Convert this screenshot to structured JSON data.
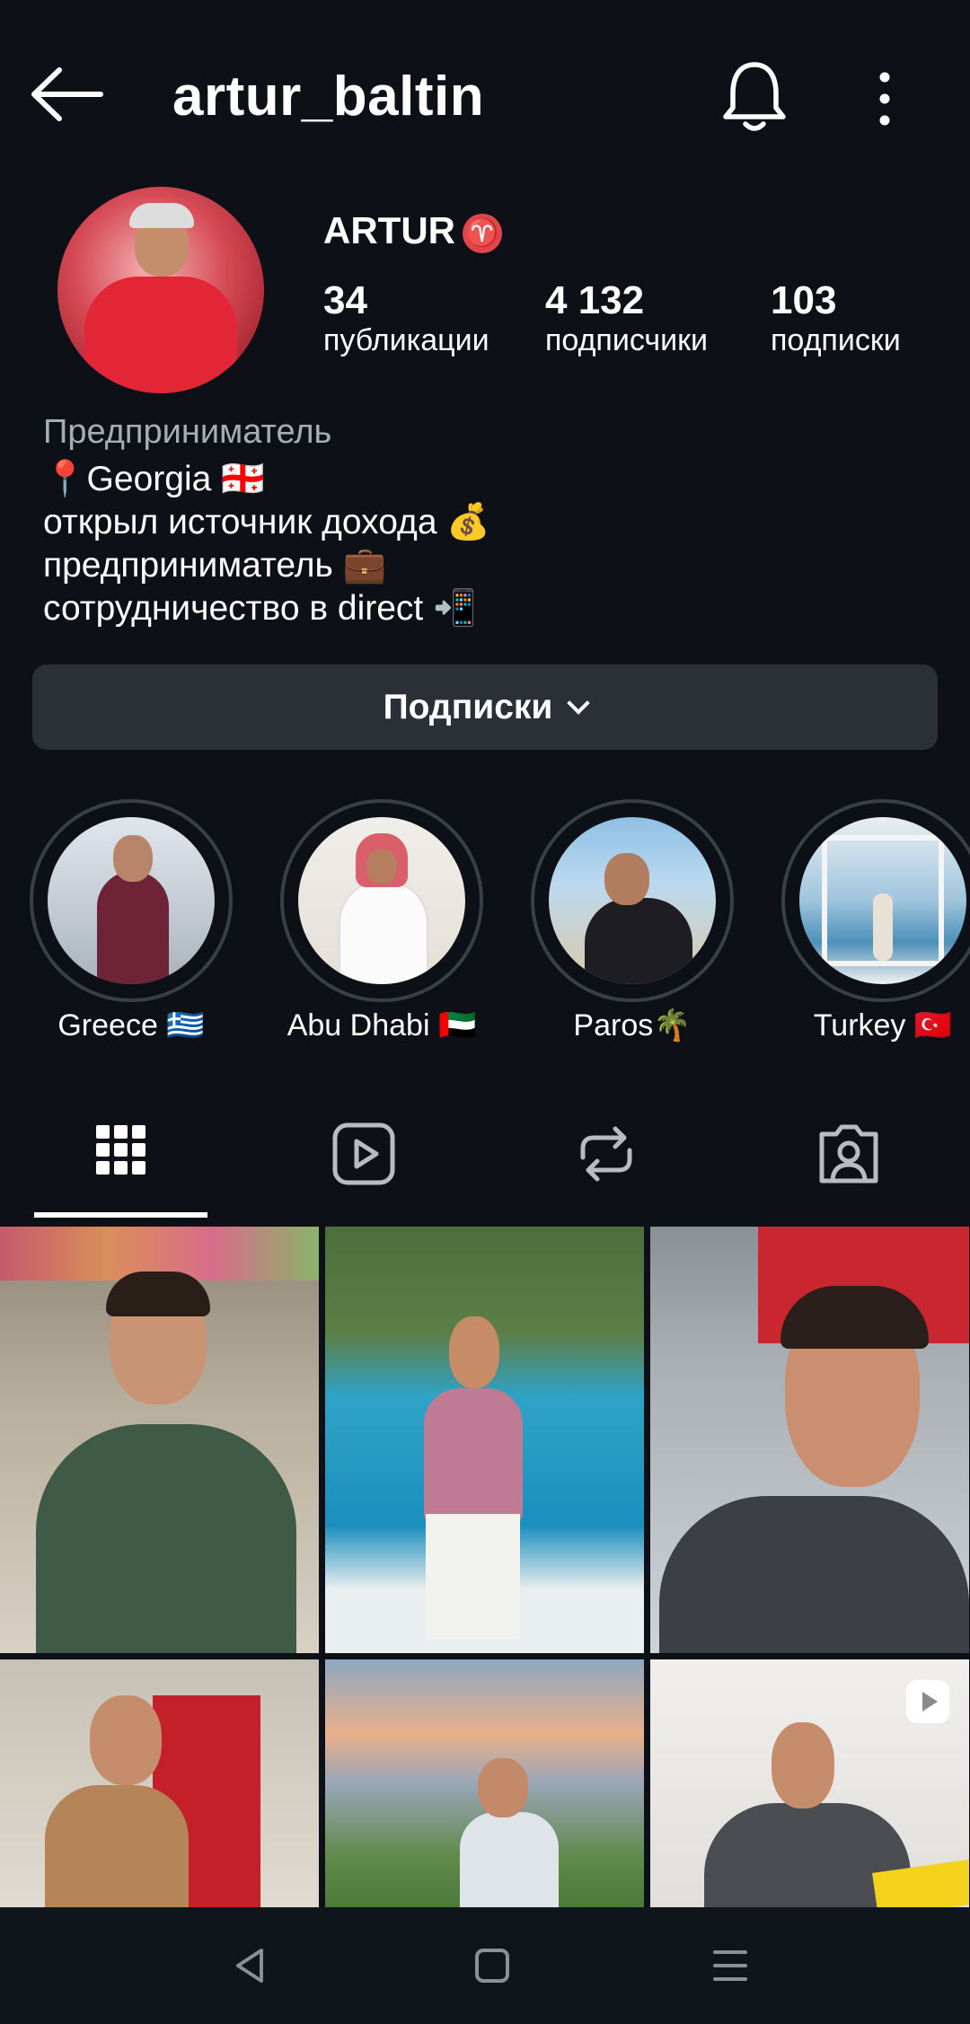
{
  "header": {
    "username": "artur_baltin"
  },
  "profile": {
    "display_name": "ARTUR",
    "zodiac_symbol": "♈",
    "stats": [
      {
        "value": "34",
        "label": "публикации"
      },
      {
        "value": "4 132",
        "label": "подписчики"
      },
      {
        "value": "103",
        "label": "подписки"
      }
    ],
    "category": "Предприниматель",
    "bio": [
      "📍Georgia 🇬🇪",
      "открыл источник дохода 💰",
      "предприниматель 💼",
      "сотрудничество в direct 📲"
    ]
  },
  "follow_button": {
    "label": "Подписки"
  },
  "highlights": [
    {
      "label": "Greece 🇬🇷"
    },
    {
      "label": "Abu Dhabi 🇦🇪"
    },
    {
      "label": "Paros🌴"
    },
    {
      "label": "Turkey 🇹🇷"
    }
  ],
  "tabs": [
    "grid-icon",
    "reels-icon",
    "reposts-icon",
    "tagged-icon"
  ],
  "colors": {
    "background": "#0d1117",
    "button_bg": "#2b3036",
    "secondary_text": "#a8adb4",
    "highlight_ring": "#3a3f46"
  }
}
